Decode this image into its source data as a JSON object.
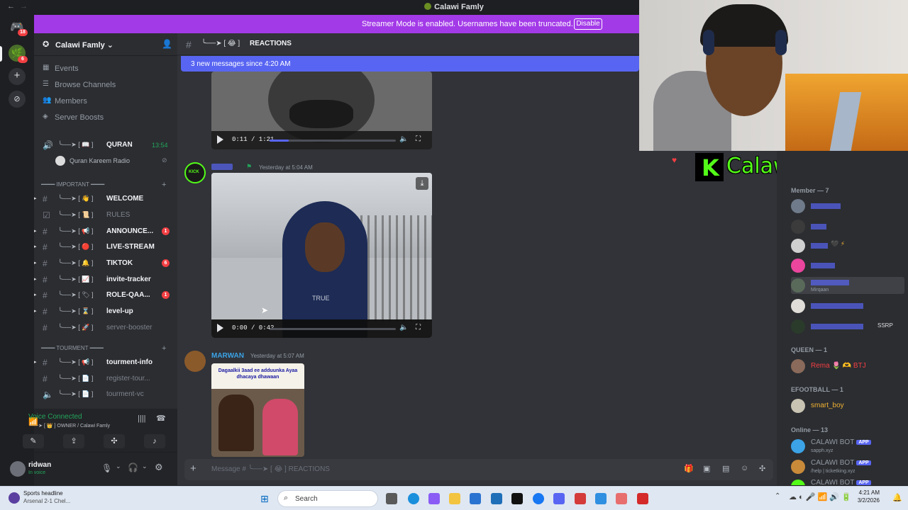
{
  "window": {
    "title": "Calawi Famly"
  },
  "banner": {
    "text": "Streamer Mode is enabled. Usernames have been truncated.",
    "button": "Disable"
  },
  "rail": {
    "badge_top": "18",
    "badge_server": "6"
  },
  "server": {
    "name": "Calawi Famly",
    "menu": [
      {
        "label": "Events",
        "icon": "calendar-icon"
      },
      {
        "label": "Browse Channels",
        "icon": "list-icon"
      },
      {
        "label": "Members",
        "icon": "people-icon"
      },
      {
        "label": "Server Boosts",
        "icon": "boost-icon"
      }
    ],
    "voice_channel": {
      "name": "QURAN",
      "deco": "╰──➤ [ 📖 ]",
      "time": "13:54",
      "member": "Quran Kareem Radio"
    },
    "categories": [
      {
        "label": "━━━━ IMPORTANT ━━━━"
      },
      {
        "label": "━━━━ TOURMENT ━━━━"
      }
    ],
    "channels": [
      {
        "deco": "╰──➤ [ 👋 ]",
        "name": "WELCOME",
        "badge": "",
        "muted": false
      },
      {
        "deco": "╰──➤ [ 📜 ]",
        "name": "RULES",
        "badge": "",
        "muted": true
      },
      {
        "deco": "╰──➤ [ 📢 ]",
        "name": "ANNOUNCE...",
        "badge": "1",
        "muted": false
      },
      {
        "deco": "╰──➤ [ 🔴 ]",
        "name": "LIVE-STREAM",
        "badge": "",
        "muted": false
      },
      {
        "deco": "╰──➤ [ 🔔 ]",
        "name": "TIKTOK",
        "badge": "6",
        "muted": false
      },
      {
        "deco": "╰──➤ [ 📈 ]",
        "name": "invite-tracker",
        "badge": "",
        "muted": false
      },
      {
        "deco": "╰──➤ [ 🏷 ]",
        "name": "ROLE-QAA...",
        "badge": "1",
        "muted": false
      },
      {
        "deco": "╰──➤ [ ⌛ ]",
        "name": "level-up",
        "badge": "",
        "muted": false
      },
      {
        "deco": "╰──➤ [ 🚀 ]",
        "name": "server-booster",
        "badge": "",
        "muted": true
      },
      {
        "deco": "╰──➤ [ 📢 ]",
        "name": "tourment-info",
        "badge": "",
        "muted": false
      },
      {
        "deco": "╰──➤ [ 📄 ]",
        "name": "register-tour...",
        "badge": "",
        "muted": true
      },
      {
        "deco": "╰──➤ [ 📄 ]",
        "name": "tourment-vc",
        "badge": "",
        "muted": true
      }
    ],
    "voice_status": {
      "title": "Voice Connected",
      "sub": "╰──➤ [ 👑 ] OWNER / Calawi Famly"
    },
    "user": {
      "name": "ridwan",
      "status": "In voice"
    }
  },
  "chat": {
    "channel_deco": "╰──➤ [ 😂 ]",
    "channel_name": "REACTIONS",
    "new_messages": "3 new messages since 4:20 AM",
    "video1": {
      "time": "0:11 / 1:21",
      "progress": 0.15
    },
    "msg2": {
      "author": "KICK",
      "timestamp": "Yesterday at 5:04 AM",
      "caption": "TRUE"
    },
    "video2": {
      "time": "0:00 / 0:42",
      "progress": 0.0
    },
    "msg3": {
      "author": "MARWAN",
      "timestamp": "Yesterday at 5:07 AM",
      "caption": "Dagaalkii 3aad ee adduunka Ayaa dhacaya dhawaan"
    },
    "composer_placeholder": "Message # ╰──➤ [ 😂 ] REACTIONS"
  },
  "overlay": {
    "kick_text": "Calawi_live"
  },
  "members": {
    "groups": [
      {
        "label": "Member — 7",
        "items": [
          {
            "name": "",
            "color": "#5865f2",
            "sub": ""
          },
          {
            "name": "",
            "color": "#5865f2",
            "sub": ""
          },
          {
            "name": "",
            "color": "#5865f2",
            "sub": ""
          },
          {
            "name": "",
            "color": "#5865f2",
            "sub": ""
          },
          {
            "name": "",
            "color": "#5865f2",
            "sub": "Mirqaan"
          },
          {
            "name": "",
            "color": "#5865f2",
            "sub": ""
          },
          {
            "name": "",
            "color": "#5865f2",
            "sub": "SSRP"
          }
        ]
      },
      {
        "label": "QUEEN — 1",
        "items": [
          {
            "name": "Rema 🌷 🫶 BTJ",
            "color": "#f23f43",
            "sub": ""
          }
        ]
      },
      {
        "label": "EFOOTBALL — 1",
        "items": [
          {
            "name": "smart_boy",
            "color": "#f0b232",
            "sub": ""
          }
        ]
      },
      {
        "label": "Online — 13",
        "items": [
          {
            "name": "CALAWI BOT",
            "color": "#949ba4",
            "sub": "sapph.xyz",
            "tag": "APP"
          },
          {
            "name": "CALAWI BOT",
            "color": "#949ba4",
            "sub": "/help | ticketking.xyz",
            "tag": "APP"
          },
          {
            "name": "CALAWI BOT",
            "color": "#949ba4",
            "sub": "",
            "tag": "APP"
          }
        ]
      }
    ]
  },
  "taskbar": {
    "news_title": "Sports headline",
    "news_sub": "Arsenal 2-1 Chel...",
    "search": "Search",
    "time": "4:21 AM",
    "date": "3/2/2026"
  }
}
